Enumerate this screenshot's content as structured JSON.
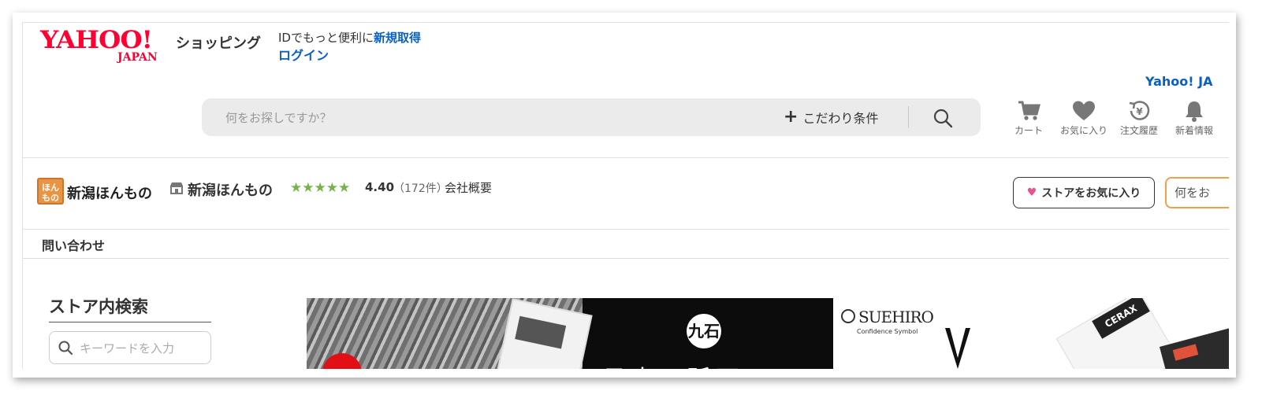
{
  "header": {
    "logo_yahoo": "YAHOO!",
    "logo_japan": "JAPAN",
    "shopping_label": "ショッピング",
    "id_promo_text": "IDでもっと便利に",
    "id_promo_link": "新規取得",
    "login_link": "ログイン",
    "yahoo_link": "Yahoo! JA"
  },
  "search": {
    "placeholder": "何をお探しですか？",
    "conditions_label": "こだわり条件",
    "conditions_icon": "plus-icon",
    "search_icon": "search-icon"
  },
  "nav": {
    "items": [
      {
        "label": "カート",
        "icon": "cart-icon"
      },
      {
        "label": "お気に入り",
        "icon": "heart-icon"
      },
      {
        "label": "注文履歴",
        "icon": "order-history-icon"
      },
      {
        "label": "新着情報",
        "icon": "bell-icon"
      }
    ]
  },
  "store": {
    "logo_text": "新潟ほんもの",
    "name": "新潟ほんもの",
    "stars": "★★★★★",
    "rating": "4.40",
    "review_count": "（172件）",
    "company_link": "会社概要",
    "favorite_button": "ストアをお気に入り",
    "store_search_placeholder": "何をお",
    "contact_link": "問い合わせ"
  },
  "sidebar": {
    "title": "ストア内検索",
    "keyword_placeholder": "キーワードを入力"
  },
  "banners": {
    "banner1_seal": "九石",
    "banner1_text": "日本の砥石",
    "banner2_brand": "SUEHIRO",
    "banner2_tagline": "Confidence Symbol",
    "banner2_product": "CERAX"
  },
  "colors": {
    "brand_red": "#ff0033",
    "link_blue": "#0a5fc7",
    "star_green": "#78b34a",
    "accent_orange": "#f0a04b",
    "heart_pink": "#e2568f"
  }
}
